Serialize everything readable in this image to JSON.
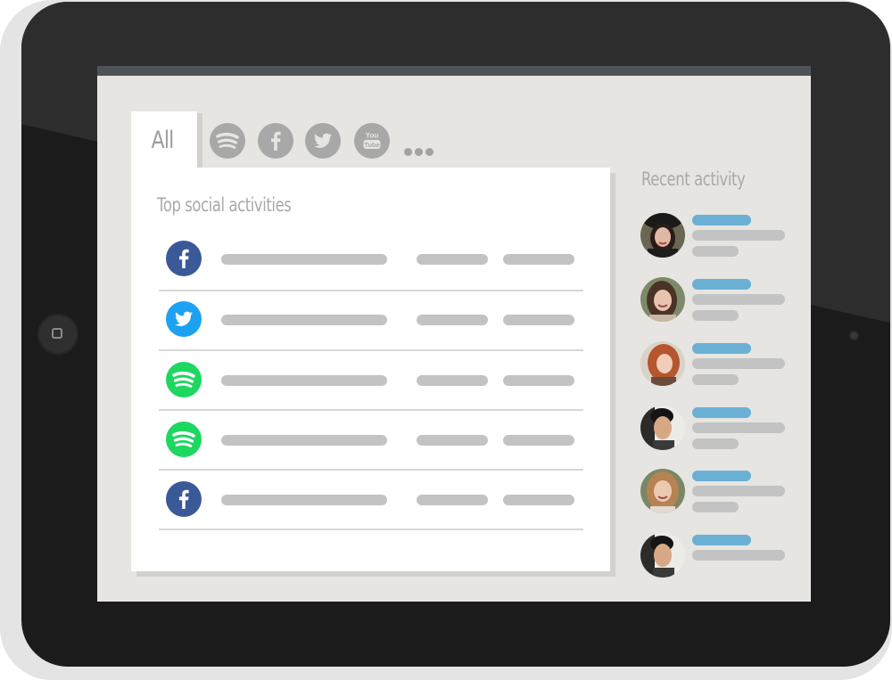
{
  "tabs": {
    "all_label": "All",
    "icons": [
      "spotify-icon",
      "facebook-icon",
      "twitter-icon",
      "youtube-icon",
      "more-icon"
    ],
    "youtube_text_top": "You",
    "youtube_text_bottom": "Tube"
  },
  "top_social": {
    "title": "Top social activities",
    "rows": [
      {
        "network": "facebook",
        "color": "#3b5998"
      },
      {
        "network": "twitter",
        "color": "#1da1f2"
      },
      {
        "network": "spotify",
        "color": "#1ed760"
      },
      {
        "network": "spotify",
        "color": "#1ed760"
      },
      {
        "network": "facebook",
        "color": "#3b5998"
      }
    ]
  },
  "recent_activity": {
    "title": "Recent activity",
    "items": [
      {
        "avatar": "avatar-woman-dark-hair-hat"
      },
      {
        "avatar": "avatar-woman-smiling"
      },
      {
        "avatar": "avatar-woman-red-hair"
      },
      {
        "avatar": "avatar-man-dark-hair"
      },
      {
        "avatar": "avatar-woman-blonde"
      },
      {
        "avatar": "avatar-man-dark-hair"
      }
    ]
  },
  "colors": {
    "accent_bar": "#6ab0d4",
    "placeholder_bar": "#c3c3c3",
    "inactive_icon": "#a8a8a8",
    "facebook": "#3b5998",
    "twitter": "#1da1f2",
    "spotify": "#1ed760"
  }
}
